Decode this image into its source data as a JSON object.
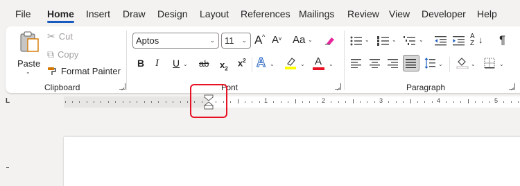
{
  "menu": {
    "tabs": [
      {
        "label": "File"
      },
      {
        "label": "Home",
        "active": true
      },
      {
        "label": "Insert"
      },
      {
        "label": "Draw"
      },
      {
        "label": "Design"
      },
      {
        "label": "Layout"
      },
      {
        "label": "References"
      },
      {
        "label": "Mailings"
      },
      {
        "label": "Review"
      },
      {
        "label": "View"
      },
      {
        "label": "Developer"
      },
      {
        "label": "Help"
      }
    ]
  },
  "clipboard": {
    "paste_label": "Paste",
    "cut_label": "Cut",
    "copy_label": "Copy",
    "format_painter_label": "Format Painter",
    "group_label": "Clipboard"
  },
  "font": {
    "font_name": "Aptos",
    "font_size": "11",
    "change_case_label": "Aa",
    "bold_label": "B",
    "italic_label": "I",
    "underline_label": "U",
    "strike_label": "ab",
    "subscript_label": "x",
    "subscript_mark": "2",
    "superscript_label": "x",
    "superscript_mark": "2",
    "text_effects_label": "A",
    "font_color_label": "A",
    "grow_label": "A",
    "shrink_label": "A",
    "group_label": "Font",
    "highlight_color": "#ffff00",
    "font_color": "#e81123"
  },
  "paragraph": {
    "group_label": "Paragraph",
    "sort_label": "A",
    "pilcrow_label": "¶"
  },
  "ruler": {
    "numbers": [
      "1",
      "2",
      "3",
      "4",
      "5"
    ],
    "tab_selector_label": "L"
  },
  "colors": {
    "accent": "#185abd",
    "highlight_box": "#e81123"
  }
}
